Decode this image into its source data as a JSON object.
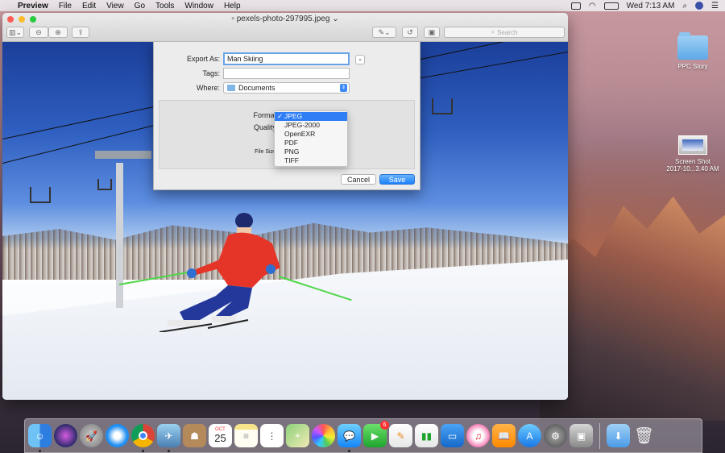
{
  "menubar": {
    "app_name": "Preview",
    "items": [
      "File",
      "Edit",
      "View",
      "Go",
      "Tools",
      "Window",
      "Help"
    ],
    "clock": "Wed 7:13 AM"
  },
  "window": {
    "title": "pexels-photo-297995.jpeg",
    "search_placeholder": "Search"
  },
  "dialog": {
    "export_as_label": "Export As:",
    "export_as_value": "Man Skiing",
    "tags_label": "Tags:",
    "where_label": "Where:",
    "where_value": "Documents",
    "format_label": "Format",
    "quality_label": "Quality",
    "file_size_label": "File Size",
    "cancel_label": "Cancel",
    "save_label": "Save",
    "format_options": [
      "JPEG",
      "JPEG-2000",
      "OpenEXR",
      "PDF",
      "PNG",
      "TIFF"
    ],
    "selected_format": "JPEG",
    "checkmark": "✓"
  },
  "desktop_icons": [
    {
      "label": "PPC Story"
    },
    {
      "label_line1": "Screen Shot",
      "label_line2": "2017-10...3.40 AM"
    }
  ],
  "dock": {
    "calendar_month": "OCT",
    "calendar_day": "25",
    "facetime_badge": "6"
  }
}
